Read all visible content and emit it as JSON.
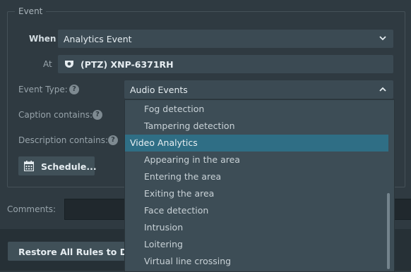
{
  "event_panel": {
    "legend": "Event",
    "when_label": "When",
    "when_value": "Analytics Event",
    "at_label": "At",
    "at_value": "(PTZ) XNP-6371RH",
    "event_type_label": "Event Type:",
    "event_type_value": "Audio Events",
    "caption_label": "Caption contains:",
    "description_label": "Description contains:",
    "schedule_button": "Schedule..."
  },
  "comments_label": "Comments:",
  "restore_button": "Restore All Rules to Defau",
  "help_glyph": "?",
  "dropdown_items": [
    {
      "label": "Fog detection",
      "group": false,
      "selected": false
    },
    {
      "label": "Tampering detection",
      "group": false,
      "selected": false
    },
    {
      "label": "Video Analytics",
      "group": true,
      "selected": true
    },
    {
      "label": "Appearing in the area",
      "group": false,
      "selected": false
    },
    {
      "label": "Entering the area",
      "group": false,
      "selected": false
    },
    {
      "label": "Exiting the area",
      "group": false,
      "selected": false
    },
    {
      "label": "Face detection",
      "group": false,
      "selected": false
    },
    {
      "label": "Intrusion",
      "group": false,
      "selected": false
    },
    {
      "label": "Loitering",
      "group": false,
      "selected": false
    },
    {
      "label": "Virtual line crossing",
      "group": false,
      "selected": false
    }
  ],
  "icons": {
    "camera": "dome-camera-icon",
    "calendar": "calendar-icon",
    "chevron_down": "chevron-down-icon",
    "chevron_up": "chevron-up-icon",
    "help": "help-circle-icon"
  },
  "colors": {
    "background": "#2f3a41",
    "field": "#3b4a53",
    "selected_item": "#2f6e85",
    "dropdown": "#3d4d56"
  }
}
